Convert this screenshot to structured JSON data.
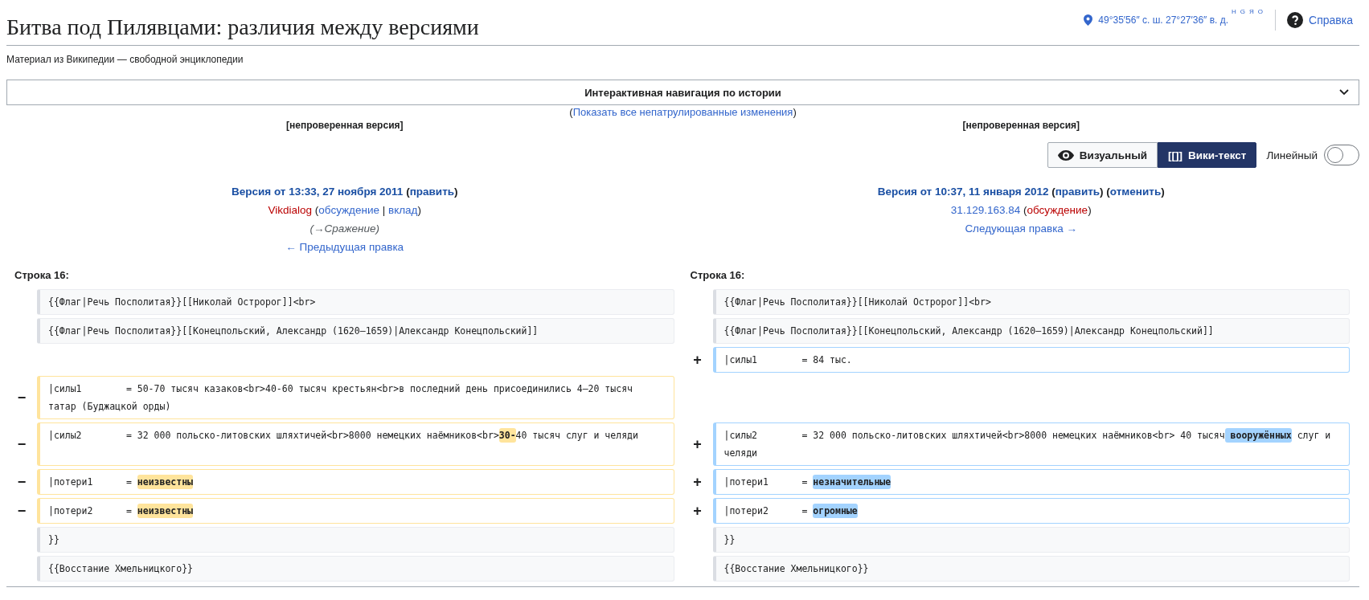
{
  "title": "Битва под Пилявцами: различия между версиями",
  "subtitle": "Материал из Википедии — свободной энциклопедии",
  "coordinates": {
    "text": "49°35′56″ с. ш. 27°27′36″ в. д.",
    "maps": [
      "H",
      "G",
      "Я",
      "O"
    ]
  },
  "help": "Справка",
  "history_nav": {
    "label": "Интерактивная навигация по истории",
    "expanded": false
  },
  "unpatrolled": [
    {
      "kind": "plain",
      "text": "("
    },
    {
      "kind": "link",
      "text": "Показать все непатрулированные изменения"
    },
    {
      "kind": "plain",
      "text": ")"
    }
  ],
  "view_switch": {
    "options": [
      {
        "kind": "eye",
        "label": "Визуальный",
        "selected": false
      },
      {
        "kind": "glyph",
        "glyph": "[[]]",
        "label": "Вики-текст",
        "selected": true
      }
    ],
    "inline_label": "Линейный",
    "inline_on": false
  },
  "revisions": [
    {
      "status": "[непроверенная версия]",
      "lines": [
        {
          "kind": "heading",
          "parts": [
            {
              "kind": "link",
              "text": "Версия от 13:33, 27 ноября 2011"
            },
            {
              "kind": "plain",
              "text": " ("
            },
            {
              "kind": "link",
              "text": "править"
            },
            {
              "kind": "plain",
              "text": ")"
            }
          ]
        },
        {
          "kind": "info",
          "parts": [
            {
              "kind": "red",
              "text": "Vikdialog"
            },
            {
              "kind": "plain",
              "text": " ("
            },
            {
              "kind": "link",
              "text": "обсуждение"
            },
            {
              "kind": "plain",
              "text": " | "
            },
            {
              "kind": "link",
              "text": "вклад"
            },
            {
              "kind": "plain",
              "text": ")"
            }
          ]
        },
        {
          "kind": "summary",
          "parts": [
            {
              "kind": "plain",
              "text": "(→Сражение)"
            }
          ]
        },
        {
          "kind": "info",
          "parts": [
            {
              "kind": "link",
              "text": "← Предыдущая правка"
            }
          ]
        }
      ]
    },
    {
      "status": "[непроверенная версия]",
      "lines": [
        {
          "kind": "heading",
          "parts": [
            {
              "kind": "link",
              "text": "Версия от 10:37, 11 января 2012"
            },
            {
              "kind": "plain",
              "text": " ("
            },
            {
              "kind": "link",
              "text": "править"
            },
            {
              "kind": "plain",
              "text": ") ("
            },
            {
              "kind": "link",
              "text": "отменить"
            },
            {
              "kind": "plain",
              "text": ")"
            }
          ]
        },
        {
          "kind": "info",
          "parts": [
            {
              "kind": "link",
              "text": "31.129.163.84"
            },
            {
              "kind": "plain",
              "text": " ("
            },
            {
              "kind": "red",
              "text": "обсуждение"
            },
            {
              "kind": "plain",
              "text": ")"
            }
          ]
        },
        {
          "kind": "info",
          "parts": [
            {
              "kind": "link",
              "text": "Следующая правка →"
            }
          ]
        }
      ]
    }
  ],
  "diff": {
    "line_headers": [
      "Строка 16:",
      "Строка 16:"
    ],
    "rows": [
      {
        "left": {
          "kind": "context",
          "parts": [
            {
              "text": "{{Флаг|Речь Посполитая}}[[Николай Остророг]]<br>",
              "changed": false
            }
          ]
        },
        "right": {
          "kind": "context",
          "parts": [
            {
              "text": "{{Флаг|Речь Посполитая}}[[Николай Остророг]]<br>",
              "changed": false
            }
          ]
        }
      },
      {
        "left": {
          "kind": "context",
          "parts": [
            {
              "text": "{{Флаг|Речь Посполитая}}[[Конецпольский, Александр (1620–1659)|Александр Конецпольский]]",
              "changed": false
            }
          ]
        },
        "right": {
          "kind": "context",
          "parts": [
            {
              "text": "{{Флаг|Речь Посполитая}}[[Конецпольский, Александр (1620–1659)|Александр Конецпольский]]",
              "changed": false
            }
          ]
        }
      },
      {
        "right": {
          "kind": "added",
          "marker": "+",
          "parts": [
            {
              "text": "|силы1        = 84 тыс.",
              "changed": false
            }
          ]
        }
      },
      {
        "left": {
          "kind": "deleted",
          "marker": "−",
          "parts": [
            {
              "text": "|силы1        = 50-70 тысяч казаков<br>40-60 тысяч крестьян<br>в последний день присоединились 4—20 тысяч татар (Буджацкой орды)",
              "changed": false
            }
          ]
        }
      },
      {
        "left": {
          "kind": "deleted",
          "marker": "−",
          "parts": [
            {
              "text": "|силы2        = 32 000 польско-литовских шляхтичей<br>8000 немецких наёмников<br>",
              "changed": false
            },
            {
              "text": "30-",
              "changed": true
            },
            {
              "text": "40 тысяч слуг и челяди",
              "changed": false
            }
          ]
        },
        "right": {
          "kind": "added",
          "marker": "+",
          "parts": [
            {
              "text": "|силы2        = 32 000 польско-литовских шляхтичей<br>8000 немецких наёмников<br> 40 тысяч",
              "changed": false
            },
            {
              "text": " вооружённых",
              "changed": true
            },
            {
              "text": " слуг и челяди",
              "changed": false
            }
          ]
        }
      },
      {
        "left": {
          "kind": "deleted",
          "marker": "−",
          "parts": [
            {
              "text": "|потери1      = ",
              "changed": false
            },
            {
              "text": "неизвестны",
              "changed": true
            }
          ]
        },
        "right": {
          "kind": "added",
          "marker": "+",
          "parts": [
            {
              "text": "|потери1      = ",
              "changed": false
            },
            {
              "text": "незначительные",
              "changed": true
            }
          ]
        }
      },
      {
        "left": {
          "kind": "deleted",
          "marker": "−",
          "parts": [
            {
              "text": "|потери2      = ",
              "changed": false
            },
            {
              "text": "неизвестны",
              "changed": true
            }
          ]
        },
        "right": {
          "kind": "added",
          "marker": "+",
          "parts": [
            {
              "text": "|потери2      = ",
              "changed": false
            },
            {
              "text": "огромные",
              "changed": true
            }
          ]
        }
      },
      {
        "left": {
          "kind": "context",
          "parts": [
            {
              "text": "}}",
              "changed": false
            }
          ]
        },
        "right": {
          "kind": "context",
          "parts": [
            {
              "text": "}}",
              "changed": false
            }
          ]
        }
      },
      {
        "left": {
          "kind": "context",
          "parts": [
            {
              "text": "{{Восстание Хмельницкого}}",
              "changed": false
            }
          ]
        },
        "right": {
          "kind": "context",
          "parts": [
            {
              "text": "{{Восстание Хмельницкого}}",
              "changed": false
            }
          ]
        }
      }
    ]
  }
}
